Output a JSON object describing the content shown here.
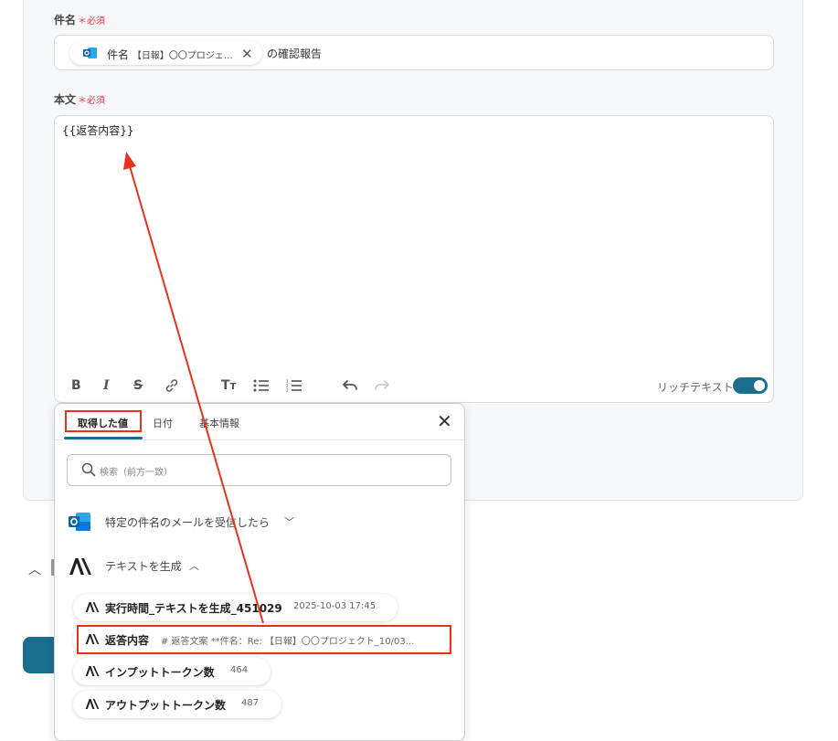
{
  "fields": {
    "subject": {
      "label": "件名",
      "required_mark": "＊必須",
      "chip_label": "件名",
      "chip_value": "【日報】〇〇プロジェ…",
      "suffix_text": "の確認報告"
    },
    "body": {
      "label": "本文",
      "required_mark": "＊必須",
      "value": "{{返答内容}}"
    }
  },
  "toolbar": {
    "rich_text_label": "リッチテキスト",
    "rich_text_enabled": true
  },
  "panel": {
    "tabs": [
      {
        "label": "取得した値",
        "active": true
      },
      {
        "label": "日付",
        "active": false
      },
      {
        "label": "基本情報",
        "active": false
      }
    ],
    "search_placeholder": "検索（前方一致）",
    "groups": [
      {
        "title": "特定の件名のメールを受信したら",
        "icon": "outlook-icon",
        "expanded": false
      },
      {
        "title": "テキストを生成",
        "icon": "anthropic-icon",
        "expanded": true
      }
    ],
    "items": [
      {
        "name": "実行時間_テキストを生成_451029",
        "meta": "2025-10-03 17:45"
      },
      {
        "name": "返答内容",
        "meta": "# 返答文案 **件名：Re: 【日報】〇〇プロジェクト_10/03..."
      },
      {
        "name": "インプットトークン数",
        "meta": "464"
      },
      {
        "name": "アウトプットトークン数",
        "meta": "487"
      }
    ]
  },
  "colors": {
    "accent": "#1a6f8e",
    "required": "#e5364a",
    "highlight": "#e8321c"
  }
}
